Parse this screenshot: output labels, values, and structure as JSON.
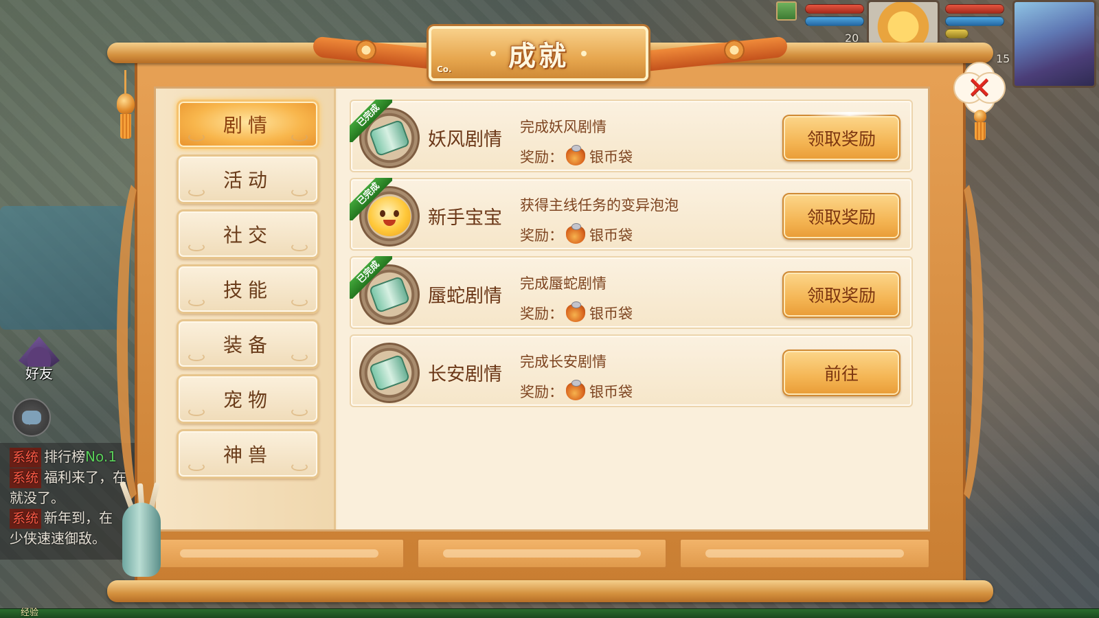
{
  "window": {
    "title": "成就",
    "corner_mark": "Co."
  },
  "hud": {
    "pet_level": "20",
    "hero_level": "15"
  },
  "left_ui": {
    "friend_label": "好友"
  },
  "chat": {
    "lines": [
      {
        "tag": "系统",
        "text": "排行榜",
        "highlight": "No.1"
      },
      {
        "tag": "系统",
        "text": "福利来了，在",
        "cont": "就没了。"
      },
      {
        "tag": "系统",
        "text": "新年到，在",
        "cont": "少侠速速御敌。"
      }
    ]
  },
  "exp_label": "经验",
  "categories": [
    {
      "label": "剧情",
      "active": true
    },
    {
      "label": "活动",
      "active": false
    },
    {
      "label": "社交",
      "active": false
    },
    {
      "label": "技能",
      "active": false
    },
    {
      "label": "装备",
      "active": false
    },
    {
      "label": "宠物",
      "active": false
    },
    {
      "label": "神兽",
      "active": false
    }
  ],
  "achievements": [
    {
      "name": "妖风剧情",
      "desc": "完成妖风剧情",
      "reward_label": "奖励：",
      "reward_item": "银币袋",
      "completed": true,
      "completed_tag": "已完成",
      "icon": "scroll-icon",
      "action": "领取奖励"
    },
    {
      "name": "新手宝宝",
      "desc": "获得主线任务的变异泡泡",
      "reward_label": "奖励：",
      "reward_item": "银币袋",
      "completed": true,
      "completed_tag": "已完成",
      "icon": "pet-face-icon",
      "action": "领取奖励"
    },
    {
      "name": "蜃蛇剧情",
      "desc": "完成蜃蛇剧情",
      "reward_label": "奖励：",
      "reward_item": "银币袋",
      "completed": true,
      "completed_tag": "已完成",
      "icon": "scroll-icon",
      "action": "领取奖励"
    },
    {
      "name": "长安剧情",
      "desc": "完成长安剧情",
      "reward_label": "奖励：",
      "reward_item": "银币袋",
      "completed": false,
      "completed_tag": "",
      "icon": "scroll-icon",
      "action": "前往"
    }
  ],
  "colors": {
    "active_tab": "#f8b64c",
    "completed_band": "#2f8f2a",
    "close_x": "#e12a20"
  }
}
